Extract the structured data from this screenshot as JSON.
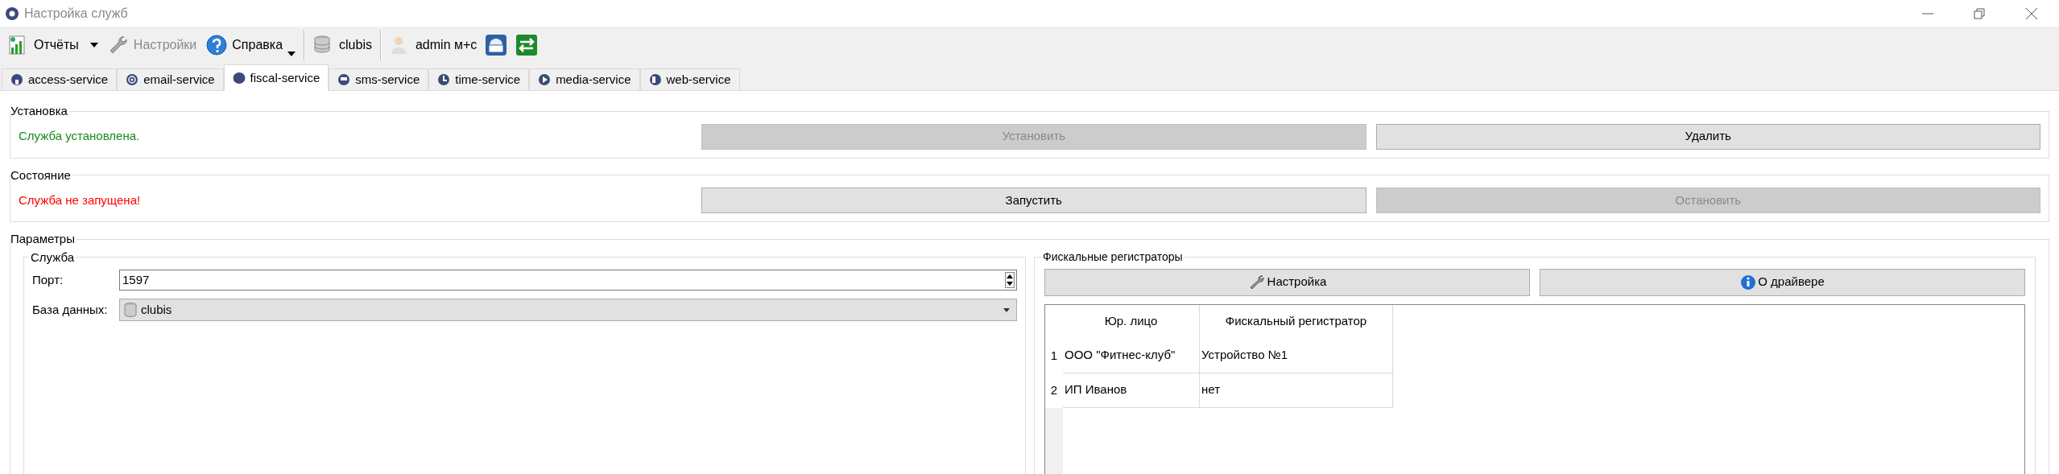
{
  "window": {
    "title": "Настройка служб"
  },
  "toolbar": {
    "groups": [
      [
        {
          "label": "Отчёты",
          "disabled": false,
          "dropdown": true
        },
        {
          "label": "Настройки",
          "disabled": true,
          "dropdown": false
        },
        {
          "label": "Справка",
          "disabled": false,
          "dropdown": true
        }
      ],
      [
        {
          "label": "clubis",
          "disabled": false,
          "dropdown": false
        }
      ],
      [
        {
          "label": "admin м+с",
          "disabled": false,
          "dropdown": false
        }
      ]
    ]
  },
  "tabs": [
    {
      "label": "access-service",
      "selected": false
    },
    {
      "label": "email-service",
      "selected": false
    },
    {
      "label": "fiscal-service",
      "selected": true
    },
    {
      "label": "sms-service",
      "selected": false
    },
    {
      "label": "time-service",
      "selected": false
    },
    {
      "label": "media-service",
      "selected": false
    },
    {
      "label": "web-service",
      "selected": false
    }
  ],
  "sections": [
    {
      "title": "Установка",
      "status": {
        "text": "Служба установлена.",
        "kind": "ok"
      },
      "buttons": [
        {
          "label": "Установить",
          "disabled": true
        },
        {
          "label": "Удалить",
          "disabled": false
        }
      ]
    },
    {
      "title": "Состояние",
      "status": {
        "text": "Служба не запущена!",
        "kind": "error"
      },
      "buttons": [
        {
          "label": "Запустить",
          "disabled": false
        },
        {
          "label": "Остановить",
          "disabled": true
        }
      ]
    }
  ],
  "parameters": {
    "title": "Параметры",
    "service": {
      "title": "Служба",
      "port": {
        "label": "Порт:",
        "value": "1597"
      },
      "database": {
        "label": "База данных:",
        "value": "clubis"
      }
    },
    "fiscal": {
      "title": "Фискальные регистраторы",
      "buttons": [
        {
          "label": "Настройка"
        },
        {
          "label": "О драйвере"
        }
      ],
      "table": {
        "columns": [
          "Юр. лицо",
          "Фискальный регистратор"
        ],
        "rows": [
          {
            "number": "1",
            "legal_entity": "ООО \"Фитнес-клуб\"",
            "registrar": "Устройство №1"
          },
          {
            "number": "2",
            "legal_entity": "ИП Иванов",
            "registrar": "нет"
          }
        ]
      }
    }
  }
}
